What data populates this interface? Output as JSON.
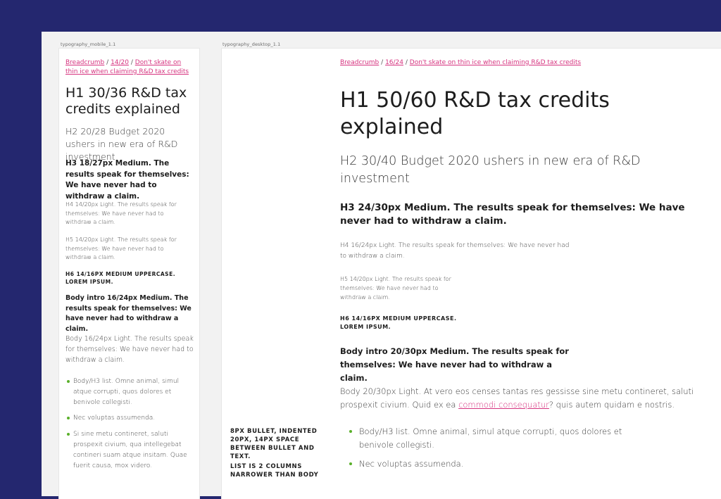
{
  "frames": {
    "mobile_label": "typography_mobile_1.1",
    "desktop_label": "typography_desktop_1.1"
  },
  "colors": {
    "background": "#24276f",
    "link": "#d6337f",
    "bullet": "#5ab02a"
  },
  "mobile": {
    "breadcrumb": [
      {
        "label": "Breadcrumb"
      },
      {
        "label": "14/20"
      },
      {
        "label": "Don't skate on thin ice when claiming R&D tax credits"
      }
    ],
    "h1": "H1 30/36 R&D tax credits explained",
    "h2": "H2 20/28 Budget 2020 ushers in new era of R&D investment",
    "h3": "H3 18/27px Medium. The results speak for themselves: We have never had to withdraw a claim.",
    "h4": "H4 14/20px Light. The results speak for themselves: We have never had to withdraw a claim.",
    "h5": "H5 14/20px Light. The results speak for themselves: We have never had to withdraw a claim.",
    "h6": "H6 14/16px Medium uppercase. Lorem ipsum.",
    "intro": "Body intro 16/24px Medium. The results speak for themselves: We have never had to withdraw a claim.",
    "body": "Body 16/24px Light. The results speak for themselves: We have never had to withdraw a claim.",
    "list": [
      "Body/H3 list. Omne animal, simul atque corrupti, quos dolores et benivole collegisti.",
      "Nec voluptas assumenda.",
      "Si sine metu contineret, saluti prospexit civium, qua intellegebat contineri suam atque insitam. Quae fuerit causa, mox videro."
    ]
  },
  "desktop": {
    "breadcrumb": [
      {
        "label": "Breadcrumb"
      },
      {
        "label": "16/24"
      },
      {
        "label": "Don't skate on thin ice when claiming R&D tax credits"
      }
    ],
    "h1": "H1 50/60 R&D tax credits explained",
    "h2": "H2 30/40 Budget 2020 ushers in new era of R&D investment",
    "h3": "H3 24/30px Medium. The results speak for themselves: We have never had to withdraw a claim.",
    "h4": "H4 16/24px Light. The results speak for themselves: We have never had to withdraw a claim.",
    "h5": "H5 14/20px Light. The results speak for themselves: We have never had to withdraw a claim.",
    "h6": "H6 14/16px Medium uppercase. Lorem ipsum.",
    "intro": "Body intro 20/30px Medium. The results speak for themselves: We have never had to withdraw a claim.",
    "body_before": "Body 20/30px Light. At vero eos censes tantas res gessisse sine metu contineret, saluti prospexit civium. Quid ex ea ",
    "body_link": "commodi consequatur",
    "body_after": "? quis autem quidam e nostris.",
    "list": [
      "Body/H3 list. Omne animal, simul atque corrupti, quos dolores et benivole collegisti.",
      "Nec voluptas assumenda."
    ],
    "note1": "8px bullet, indented 20px, 14px space between bullet and text.",
    "note2": "List is 2 columns narrower than body"
  }
}
